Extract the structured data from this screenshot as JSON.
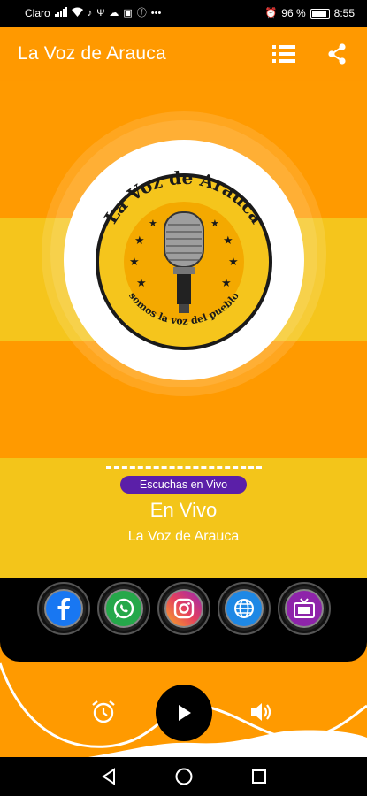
{
  "status_bar": {
    "carrier": "Claro",
    "battery_percent": "96 %",
    "time": "8:55"
  },
  "app_bar": {
    "title": "La Voz de Arauca"
  },
  "logo": {
    "top_text": "La Voz de Arauca",
    "bottom_text": "somos la voz del pueblo"
  },
  "info": {
    "badge": "Escuchas en Vivo",
    "now_playing": "En Vivo",
    "station": "La Voz de Arauca"
  },
  "social": [
    {
      "name": "facebook",
      "color": "#1877f2"
    },
    {
      "name": "whatsapp",
      "color": "#25d366"
    },
    {
      "name": "instagram",
      "color": "#e4405f"
    },
    {
      "name": "web",
      "color": "#1e88e5"
    },
    {
      "name": "tv",
      "color": "#9c27b0"
    }
  ],
  "colors": {
    "primary": "#ff9a00",
    "accent": "#f3c51a",
    "badge": "#5b1fa8"
  }
}
